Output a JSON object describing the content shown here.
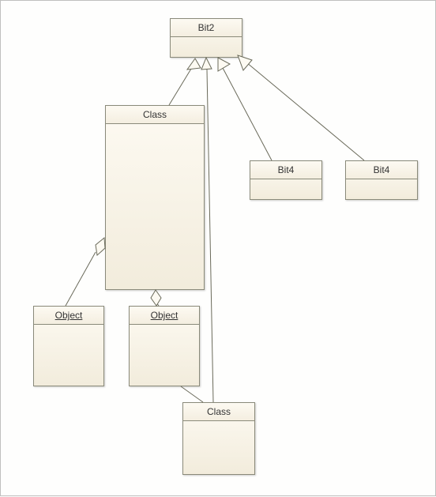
{
  "nodes": {
    "bit2": {
      "label": "Bit2"
    },
    "class_top": {
      "label": "Class"
    },
    "bit4_left": {
      "label": "Bit4"
    },
    "bit4_right": {
      "label": "Bit4"
    },
    "object_left": {
      "label": "Object"
    },
    "object_right": {
      "label": "Object"
    },
    "class_bottom": {
      "label": "Class"
    }
  },
  "connectors": [
    {
      "from": "class_top",
      "to": "bit2",
      "type": "generalization"
    },
    {
      "from": "class_bottom",
      "to": "bit2",
      "type": "generalization"
    },
    {
      "from": "bit4_left",
      "to": "bit2",
      "type": "generalization"
    },
    {
      "from": "bit4_right",
      "to": "bit2",
      "type": "generalization"
    },
    {
      "from": "object_left",
      "to": "class_top",
      "type": "aggregation"
    },
    {
      "from": "object_right",
      "to": "class_top",
      "type": "aggregation"
    },
    {
      "from": "class_bottom",
      "to": "object_right",
      "type": "association"
    }
  ]
}
